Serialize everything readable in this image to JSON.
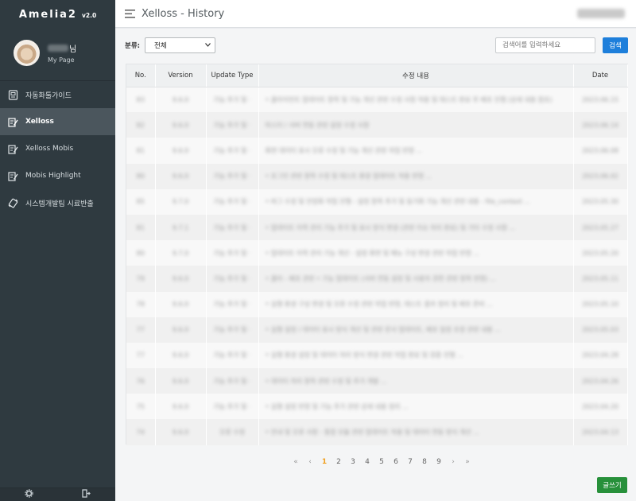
{
  "app": {
    "name": "Amelia2",
    "version": "v2.0"
  },
  "profile": {
    "name_suffix": "님",
    "mypage_label": "My Page"
  },
  "sidebar": {
    "items": [
      {
        "label": "자동화툴가이드",
        "icon": "guide-book-icon",
        "active": false
      },
      {
        "label": "Xelloss",
        "icon": "edit-note-icon",
        "active": true
      },
      {
        "label": "Xelloss Mobis",
        "icon": "edit-note-icon",
        "active": false
      },
      {
        "label": "Mobis Highlight",
        "icon": "edit-note-icon",
        "active": false
      },
      {
        "label": "시스템개발팀 시료반출",
        "icon": "transfer-icon",
        "active": false
      }
    ]
  },
  "header": {
    "title": "Xelloss - History"
  },
  "filter": {
    "label": "분류:",
    "selected": "전체"
  },
  "search": {
    "placeholder": "검색어를 입력하세요",
    "button_label": "검색"
  },
  "table": {
    "columns": [
      "No.",
      "Version",
      "Update Type",
      "수정 내용",
      "Date"
    ],
    "rows": [
      {
        "no": "83",
        "version": "9.6.0",
        "type": "기능 추가 및 ·",
        "content": "• 클라이언트 업데이트 항목 및 기능 개선 관련 수정 사항 적용 및 테스트 완료 후 배포 진행 (상세 내용 참조)",
        "date": "2023.06.15"
      },
      {
        "no": "82",
        "version": "9.6.0",
        "type": "기능 추가 및 ·",
        "content": "마스터 / 서버 연동 관련 설정 수정 사항",
        "date": "2023.06.14"
      },
      {
        "no": "81",
        "version": "9.6.0",
        "type": "기능 추가 및 ·",
        "content": "화면 데이터 표시 오류 수정 및 기능 개선 관련 작업 반영 ...",
        "date": "2023.06.08"
      },
      {
        "no": "80",
        "version": "9.6.0",
        "type": "기능 추가 및 ·",
        "content": "• 로그인 관련 항목 수정 및 테스트 환경 업데이트 적용 반영 ...",
        "date": "2023.06.02"
      },
      {
        "no": "85",
        "version": "9.7.0",
        "type": "기능 추가 및 ·",
        "content": "• 버그 수정 및 안정화 작업 진행 - 설정 항목 추가 및 동기화 기능 개선 관련 내용 - file_context ...",
        "date": "2023.05.30"
      },
      {
        "no": "81",
        "version": "9.7.1",
        "type": "기능 추가 및 ·",
        "content": "• 업데이트 이력 관리 기능 추가 및 표시 방식 변경 (관련 이슈 처리 완료) 및 기타 수정 사항 ...",
        "date": "2023.05.27"
      },
      {
        "no": "80",
        "version": "9.7.0",
        "type": "기능 추가 및 ·",
        "content": "• 업데이트 이력 관리 기능 개선 - 설정 화면 및 메뉴 구성 변경 관련 작업 반영 ...",
        "date": "2023.05.20"
      },
      {
        "no": "79",
        "version": "9.6.0",
        "type": "기능 추가 및 ·",
        "content": "• 클라 - 배포 관련 • 기능 업데이트 (서버 연동 설정 및 사용자 권한 관련 항목 반영) ...",
        "date": "2023.05.11"
      },
      {
        "no": "78",
        "version": "9.6.0",
        "type": "기능 추가 및 ·",
        "content": "• 실행 환경 구성 변경 및 오류 수정 관련 작업 반영, 테스트 결과 정리 및 배포 준비 ...",
        "date": "2023.05.10"
      },
      {
        "no": "77",
        "version": "9.6.0",
        "type": "기능 추가 및 ·",
        "content": "• 실행 설정 / 데이터 표시 방식 개선 및 관련 문서 업데이트, 배포 일정 조정 관련 내용 ...",
        "date": "2023.05.03"
      },
      {
        "no": "77",
        "version": "9.6.0",
        "type": "기능 추가 및 ·",
        "content": "• 실행 환경 설정 및 데이터 처리 방식 변경 관련 작업 완료 및 검증 진행 ...",
        "date": "2023.04.28"
      },
      {
        "no": "76",
        "version": "9.6.0",
        "type": "기능 추가 및 ·",
        "content": "• 데이터 처리 항목 관련 수정 및 추가 개발 ...",
        "date": "2023.04.26"
      },
      {
        "no": "75",
        "version": "9.6.0",
        "type": "기능 추가 및 ·",
        "content": "• 실행 설정 반영 및 기능 추가 관련 상세 내용 정리 ...",
        "date": "2023.04.20"
      },
      {
        "no": "74",
        "version": "9.6.0",
        "type": "오류 수정",
        "content": "• 안내 및 오류 사항 - 통합 모듈 관련 업데이트 적용 및 데이터 연동 방식 개선 ...",
        "date": "2023.04.13"
      }
    ]
  },
  "pagination": {
    "first": "«",
    "prev": "‹",
    "pages": [
      "1",
      "2",
      "3",
      "4",
      "5",
      "6",
      "7",
      "8",
      "9"
    ],
    "current": "1",
    "next": "›",
    "last": "»"
  },
  "write_button": "글쓰기",
  "footer": {
    "icons": [
      "settings-gear-icon",
      "logout-icon"
    ]
  }
}
